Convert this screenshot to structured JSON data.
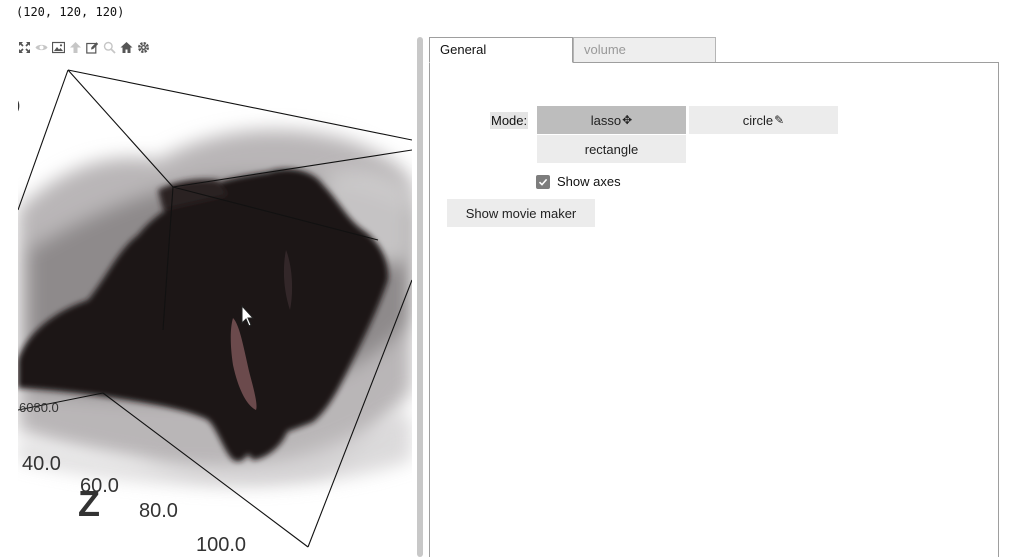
{
  "output": {
    "shape_text": "(120, 120, 120)"
  },
  "toolbar": {
    "icons": [
      "expand-icon",
      "eye-icon",
      "image-icon",
      "upload-arrow-icon",
      "edit-icon",
      "zoom-icon",
      "home-icon",
      "gear-icon"
    ]
  },
  "viewer": {
    "axis_ticks": [
      "40.0",
      "60.0",
      "80.0",
      "100.0"
    ],
    "axis_name": "Z",
    "overlapping_tick": "6080.0",
    "top_fragment": ")"
  },
  "tabs": [
    {
      "label": "General",
      "active": true
    },
    {
      "label": "volume",
      "active": false
    }
  ],
  "general": {
    "mode_label": "Mode:",
    "modes": [
      {
        "label": "lasso",
        "glyph": "✥",
        "selected": true
      },
      {
        "label": "circle",
        "glyph": "✎",
        "selected": false
      },
      {
        "label": "rectangle",
        "glyph": "",
        "selected": false
      }
    ],
    "show_axes_label": "Show axes",
    "show_axes_checked": true,
    "movie_button_label": "Show movie maker"
  },
  "colors": {
    "selected_button": "#bdbdbd",
    "button": "#ececec",
    "volume_dark": "#1f1819",
    "selection": "#6b4a4c"
  }
}
